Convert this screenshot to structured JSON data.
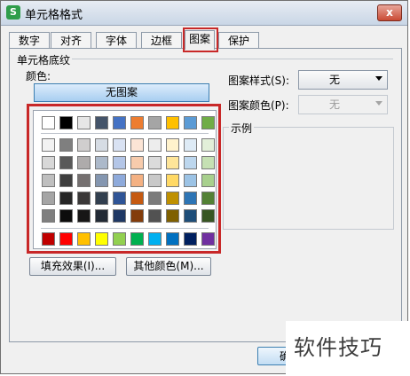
{
  "window": {
    "title": "单元格格式",
    "app_icon_text": "S",
    "close_label": "x"
  },
  "tabs": [
    {
      "label": "数字"
    },
    {
      "label": "对齐"
    },
    {
      "label": "字体"
    },
    {
      "label": "边框"
    },
    {
      "label": "图案",
      "active": true
    },
    {
      "label": "保护"
    }
  ],
  "panel": {
    "group_title": "单元格底纹",
    "color_label": "颜色:",
    "no_pattern_button": "无图案",
    "fill_effects_button": "填充效果(I)...",
    "more_colors_button": "其他颜色(M)...",
    "pattern_style_label": "图案样式(S):",
    "pattern_style_value": "无",
    "pattern_color_label": "图案颜色(P):",
    "pattern_color_value": "无",
    "sample_label": "示例"
  },
  "palette": {
    "theme_top": [
      "#ffffff",
      "#000000",
      "#e6e6e6",
      "#44546a",
      "#4472c4",
      "#ed7d31",
      "#a5a5a5",
      "#ffc000",
      "#5b9bd5",
      "#70ad47"
    ],
    "tints": [
      [
        "#f2f2f2",
        "#7f7f7f",
        "#d0cece",
        "#d6dce4",
        "#d9e2f3",
        "#fbe4d5",
        "#ededed",
        "#fff2cc",
        "#deebf6",
        "#e2efd9"
      ],
      [
        "#d8d8d8",
        "#595959",
        "#aeabab",
        "#acb9ca",
        "#b4c6e7",
        "#f7cbac",
        "#dbdbdb",
        "#fee599",
        "#bdd7ee",
        "#c5e0b3"
      ],
      [
        "#bfbfbf",
        "#3f3f3f",
        "#757070",
        "#8496b0",
        "#8eaadb",
        "#f4b183",
        "#c9c9c9",
        "#ffd965",
        "#9cc3e5",
        "#a8d08d"
      ],
      [
        "#a5a5a5",
        "#262626",
        "#3a3838",
        "#323f4f",
        "#2f5496",
        "#c55a11",
        "#7b7b7b",
        "#bf9000",
        "#2e75b5",
        "#538135"
      ],
      [
        "#7f7f7f",
        "#0c0c0c",
        "#171616",
        "#222a35",
        "#1f3864",
        "#833c0b",
        "#525252",
        "#7f6000",
        "#1e4e79",
        "#375623"
      ]
    ],
    "standard": [
      "#c00000",
      "#ff0000",
      "#ffc000",
      "#ffff00",
      "#92d050",
      "#00b050",
      "#00b0f0",
      "#0070c0",
      "#002060",
      "#7030a0"
    ]
  },
  "footer": {
    "ok_button_partial": "确"
  },
  "watermark": {
    "text": "软件技巧"
  }
}
